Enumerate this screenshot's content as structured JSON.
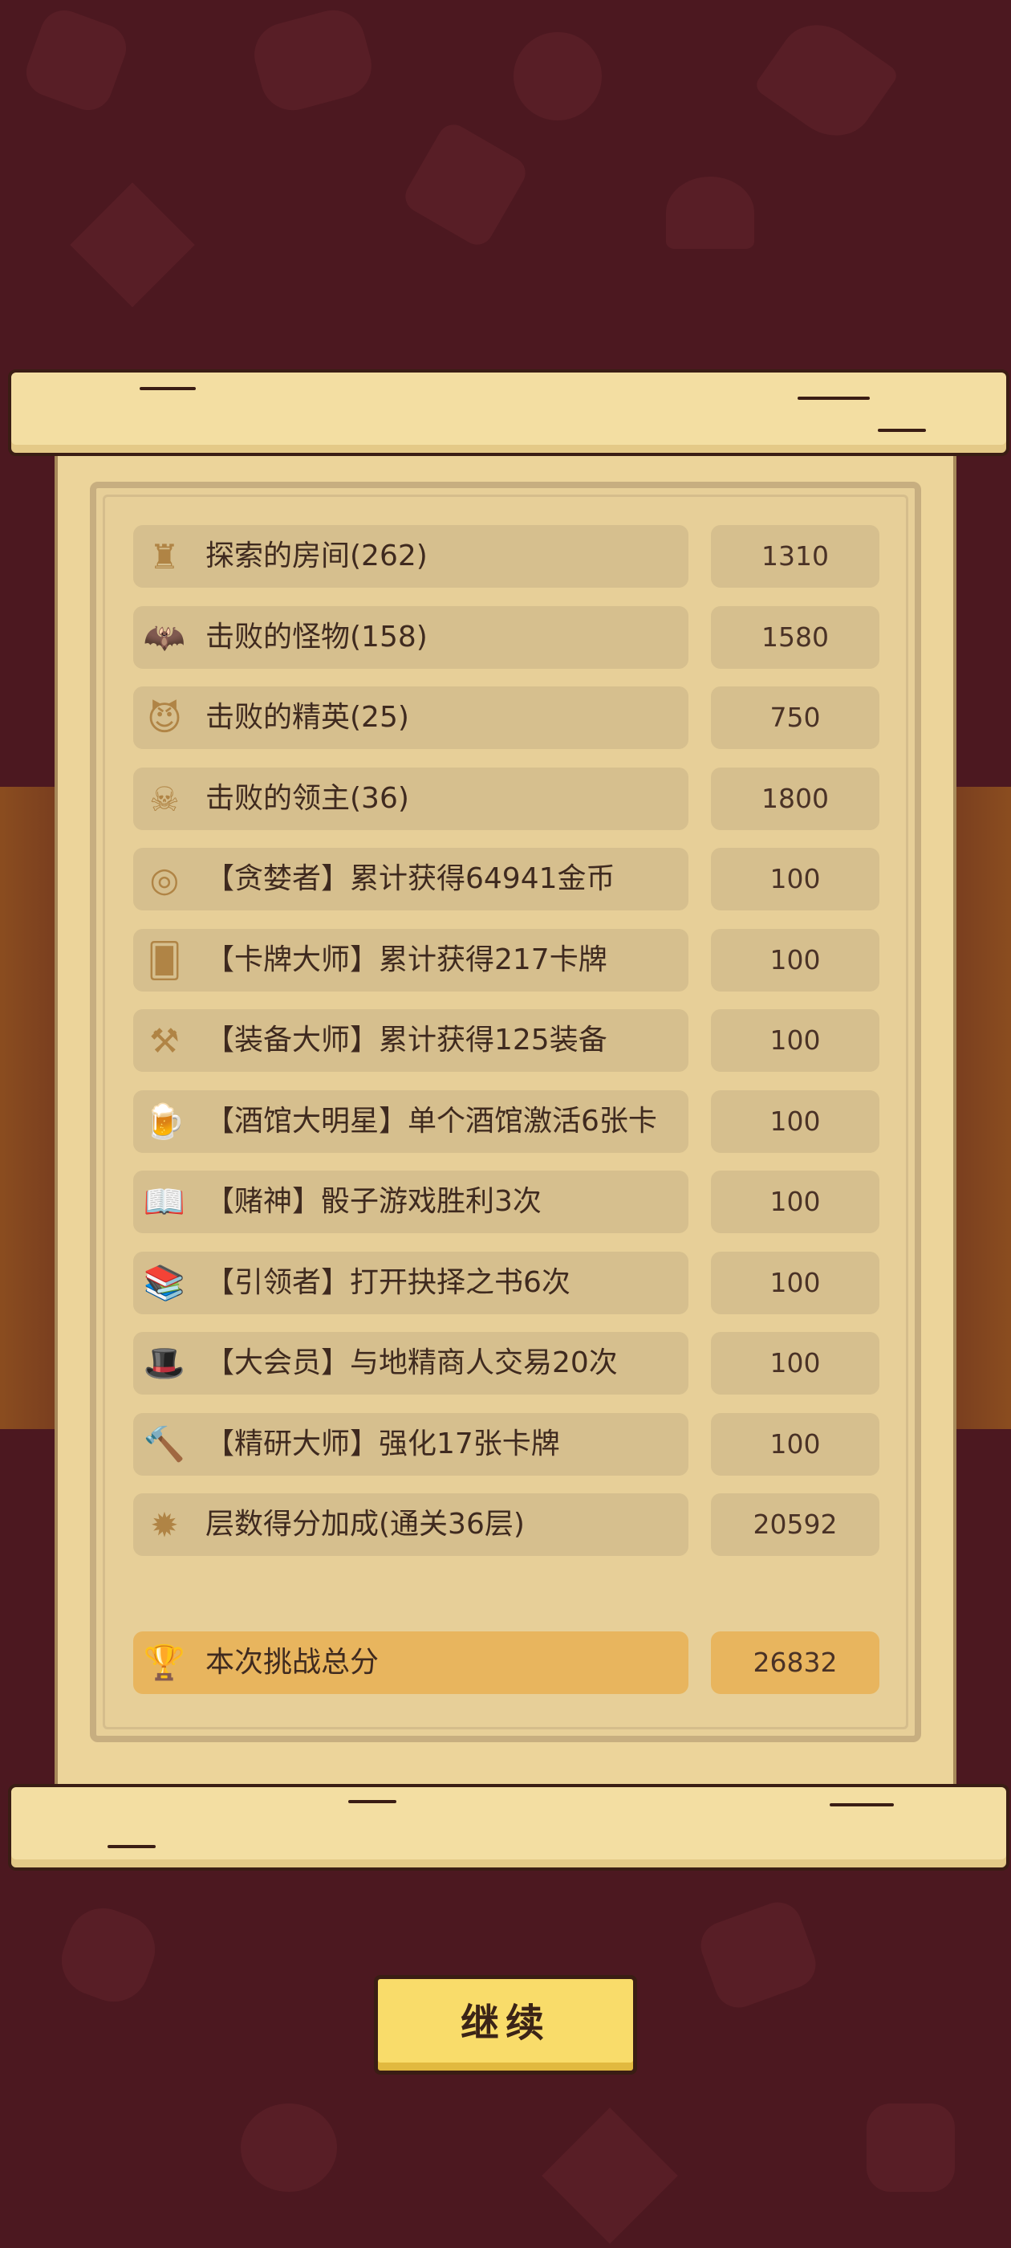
{
  "stats": [
    {
      "label": "探索的房间(262)",
      "value": "1310",
      "icon": "castle-tower-icon",
      "glyph": "♜"
    },
    {
      "label": "击败的怪物(158)",
      "value": "1580",
      "icon": "bat-icon",
      "glyph": "🦇"
    },
    {
      "label": "击败的精英(25)",
      "value": "750",
      "icon": "elite-demon-icon",
      "glyph": "😈"
    },
    {
      "label": "击败的领主(36)",
      "value": "1800",
      "icon": "boss-skull-icon",
      "glyph": "☠"
    },
    {
      "label": "【贪婪者】累计获得64941金币",
      "value": "100",
      "icon": "gold-coins-icon",
      "glyph": "◎"
    },
    {
      "label": "【卡牌大师】累计获得217卡牌",
      "value": "100",
      "icon": "cards-icon",
      "glyph": "🂠"
    },
    {
      "label": "【装备大师】累计获得125装备",
      "value": "100",
      "icon": "equipment-icon",
      "glyph": "⚒"
    },
    {
      "label": "【酒馆大明星】单个酒馆激活6张卡",
      "value": "100",
      "icon": "beer-mug-icon",
      "glyph": "🍺"
    },
    {
      "label": "【赌神】骰子游戏胜利3次",
      "value": "100",
      "icon": "open-book-icon",
      "glyph": "📖"
    },
    {
      "label": "【引领者】打开抉择之书6次",
      "value": "100",
      "icon": "book-icon",
      "glyph": "📚"
    },
    {
      "label": "【大会员】与地精商人交易20次",
      "value": "100",
      "icon": "top-hat-icon",
      "glyph": "🎩"
    },
    {
      "label": "【精研大师】强化17张卡牌",
      "value": "100",
      "icon": "hammer-icon",
      "glyph": "🔨"
    },
    {
      "label": "层数得分加成(通关36层)",
      "value": "20592",
      "icon": "floor-badge-icon",
      "glyph": "✹"
    }
  ],
  "total": {
    "label": "本次挑战总分",
    "value": "26832",
    "icon": "trophy-icon",
    "glyph": "🏆"
  },
  "continue_label": "继续"
}
